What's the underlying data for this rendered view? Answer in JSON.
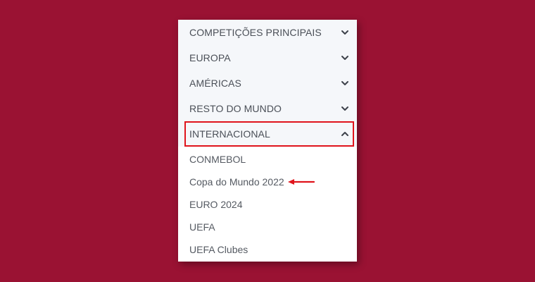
{
  "menu": {
    "sections": [
      {
        "label": "COMPETIÇÕES PRINCIPAIS",
        "icon": "chevron-down-icon"
      },
      {
        "label": "EUROPA",
        "icon": "chevron-down-icon"
      },
      {
        "label": "AMÉRICAS",
        "icon": "chevron-down-icon"
      },
      {
        "label": "RESTO DO MUNDO",
        "icon": "chevron-down-icon"
      },
      {
        "label": "INTERNACIONAL",
        "icon": "chevron-up-icon",
        "expanded": true
      }
    ],
    "subitems": [
      {
        "label": "CONMEBOL"
      },
      {
        "label": "Copa do Mundo 2022",
        "highlighted": true
      },
      {
        "label": "EURO 2024"
      },
      {
        "label": "UEFA"
      },
      {
        "label": "UEFA Clubes"
      }
    ]
  },
  "colors": {
    "background": "#9a1233",
    "highlight": "#e0141c",
    "section_bg": "#f5f7fa",
    "text": "#4a4f57"
  }
}
